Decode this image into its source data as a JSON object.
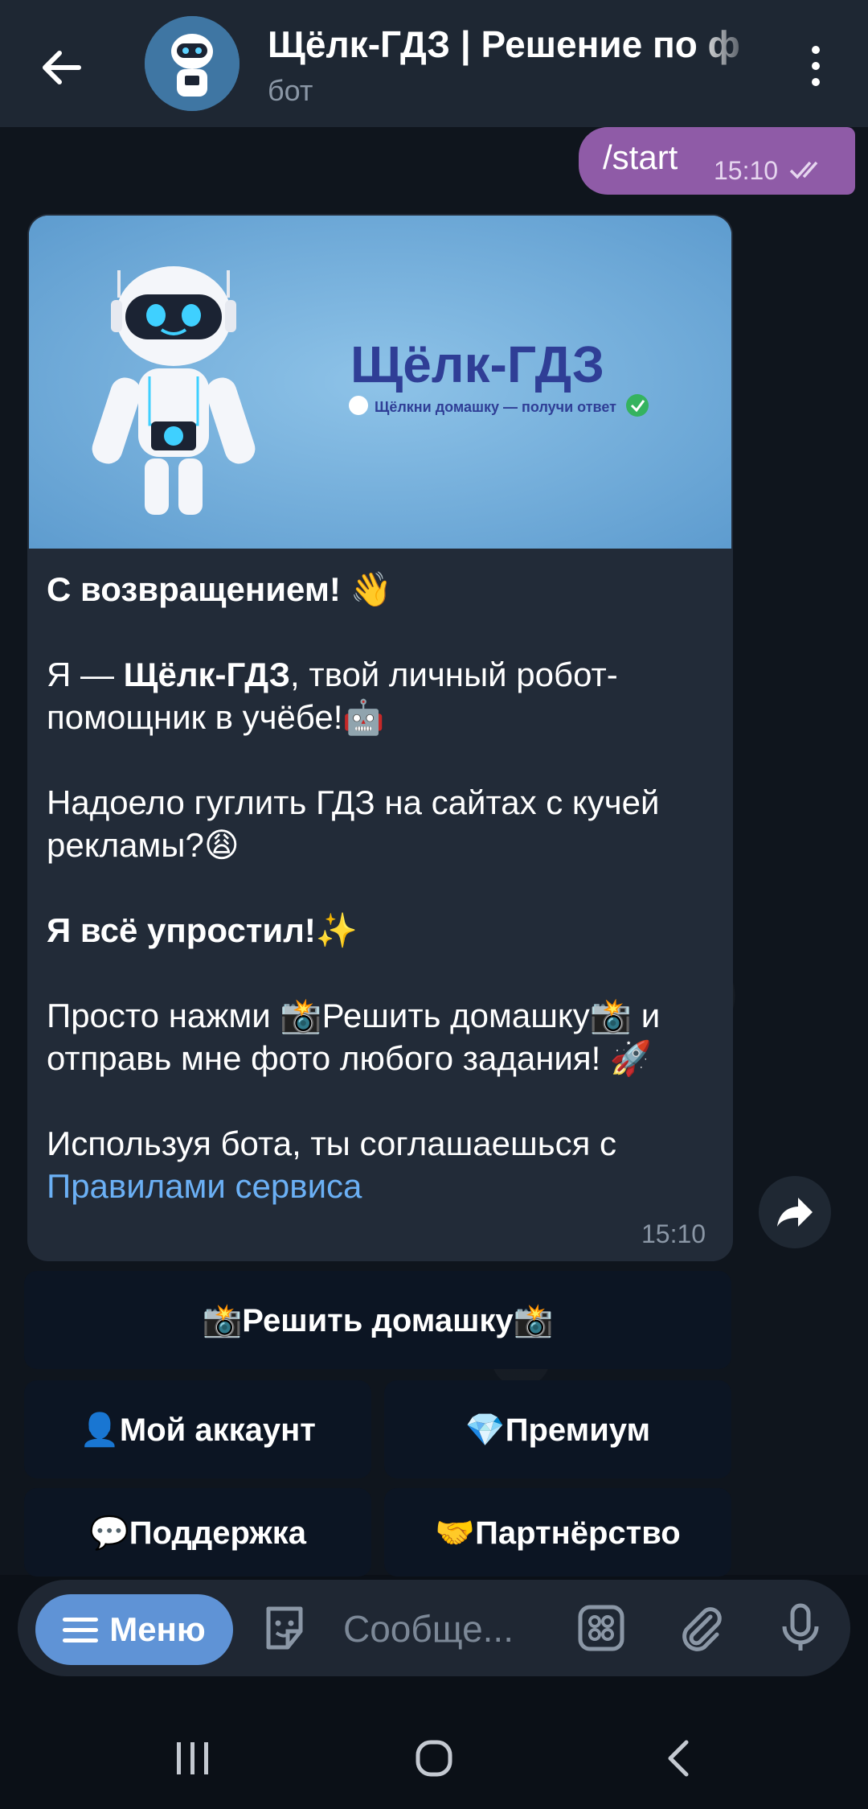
{
  "header": {
    "title": "Щёлк-ГДЗ | Решение по ф",
    "subtitle": "бот"
  },
  "outgoing": {
    "text": "/start",
    "time": "15:10"
  },
  "incoming": {
    "banner_title": "Щёлк-ГДЗ",
    "banner_tagline": "Щёлкни домашку — получи ответ",
    "greeting": "С возвращением! 👋",
    "intro_prefix": "Я — ",
    "intro_bold": "Щёлк-ГДЗ",
    "intro_rest": ", твой личный робот-помощник в учёбе!🤖",
    "question": "Надоело гуглить ГДЗ на сайтах с кучей рекламы?😩",
    "simplified": "Я всё упростил!✨",
    "instruction": "Просто нажми 📸Решить домашку📸 и отправь мне фото любого задания! 🚀",
    "terms_prefix": "Используя бота, ты соглашаешься с",
    "terms_link": "Правилами сервиса",
    "time": "15:10"
  },
  "keyboard": {
    "solve": "📸Решить домашку📸",
    "account": "👤Мой аккаунт",
    "premium": "💎Премиум",
    "support": "💬Поддержка",
    "partnership": "🤝Партнёрство"
  },
  "input": {
    "menu_label": "Меню",
    "placeholder": "Сообще..."
  },
  "colors": {
    "outgoing_bubble": "#8f5ba7",
    "incoming_bubble": "#222b38",
    "link": "#6bb0f5",
    "menu_button": "#5f93d6"
  }
}
